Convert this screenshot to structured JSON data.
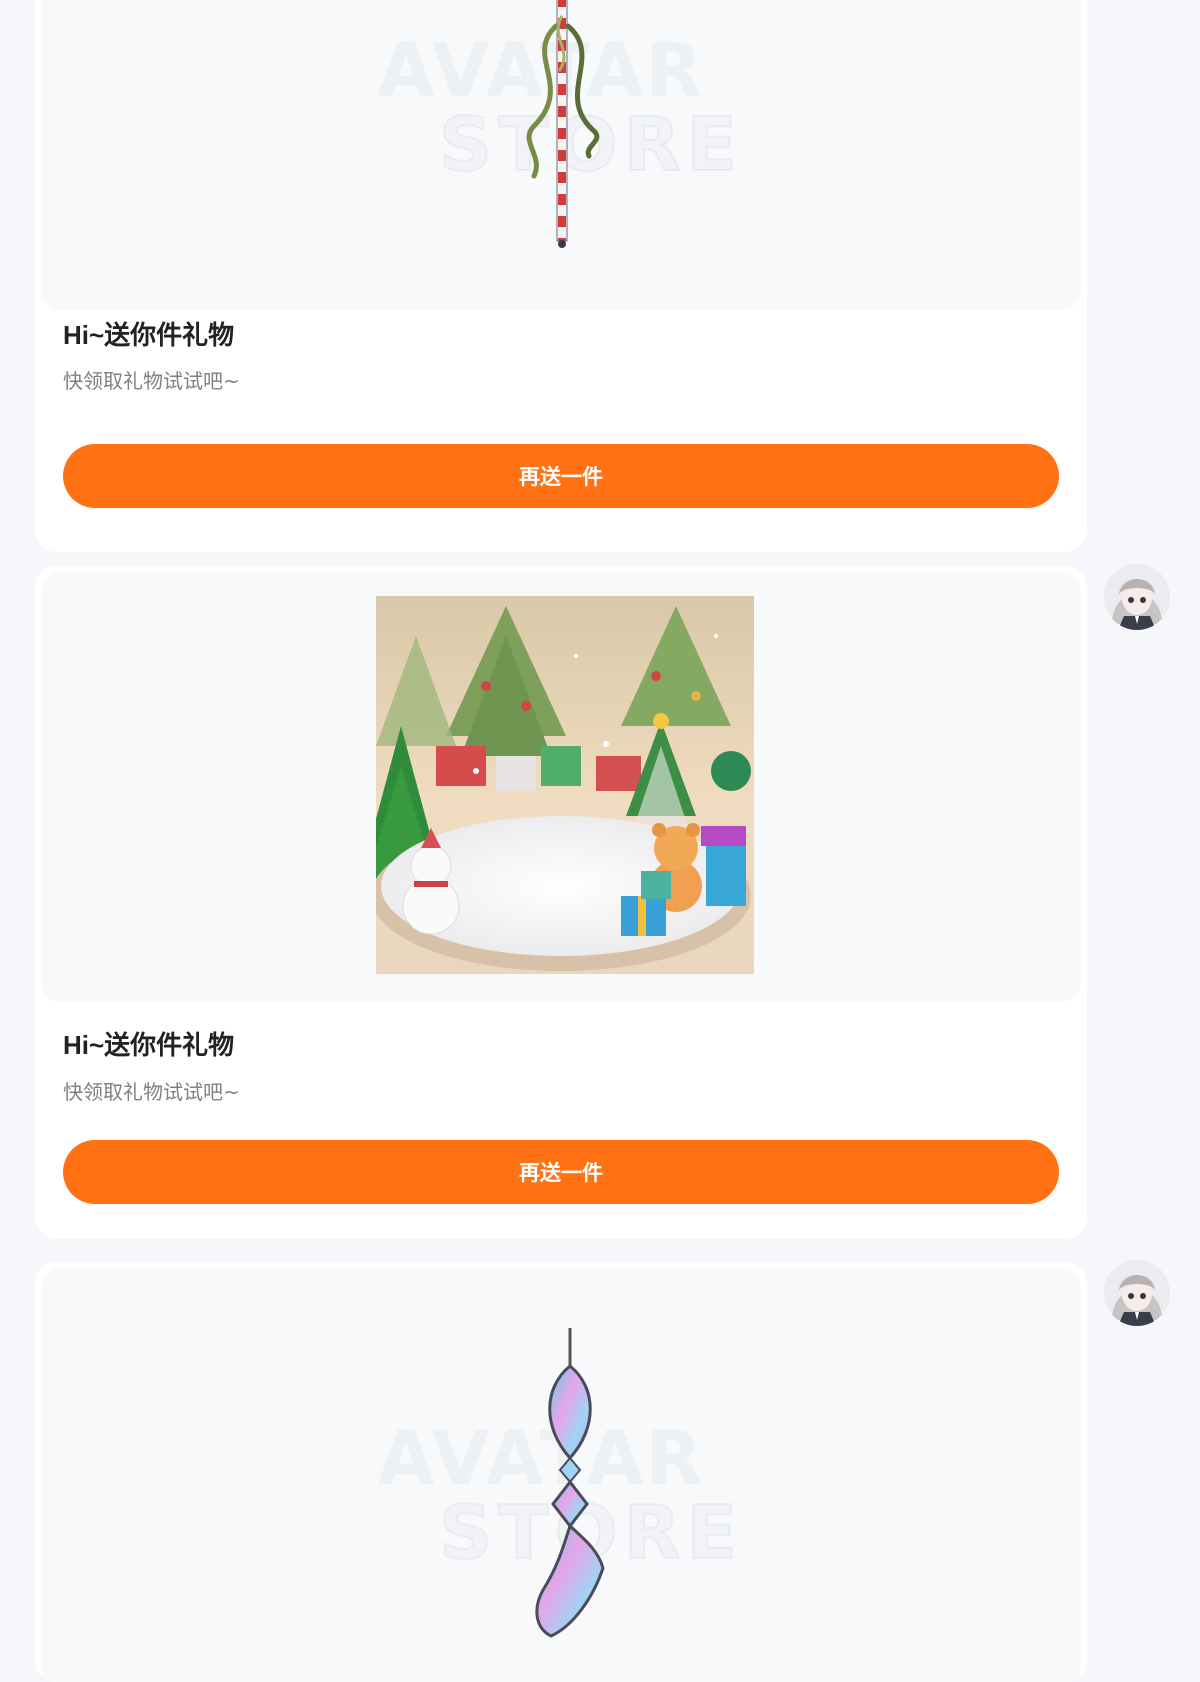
{
  "messages": [
    {
      "gift_image": "ribbon-candy-cane-pendant",
      "watermark_line1": "AVATAR",
      "watermark_line2": "STORE",
      "title": "Hi~送你件礼物",
      "subtitle": "快领取礼物试试吧~",
      "button_label": "再送一件"
    },
    {
      "gift_image": "christmas-scene-snow-stage",
      "title": "Hi~送你件礼物",
      "subtitle": "快领取礼物试试吧~",
      "button_label": "再送一件"
    },
    {
      "gift_image": "pastel-crystal-pendant",
      "watermark_line1": "AVATAR",
      "watermark_line2": "STORE"
    }
  ],
  "colors": {
    "accent": "#ff7112",
    "page_background": "#f5f7fa",
    "card_background": "#ffffff"
  }
}
